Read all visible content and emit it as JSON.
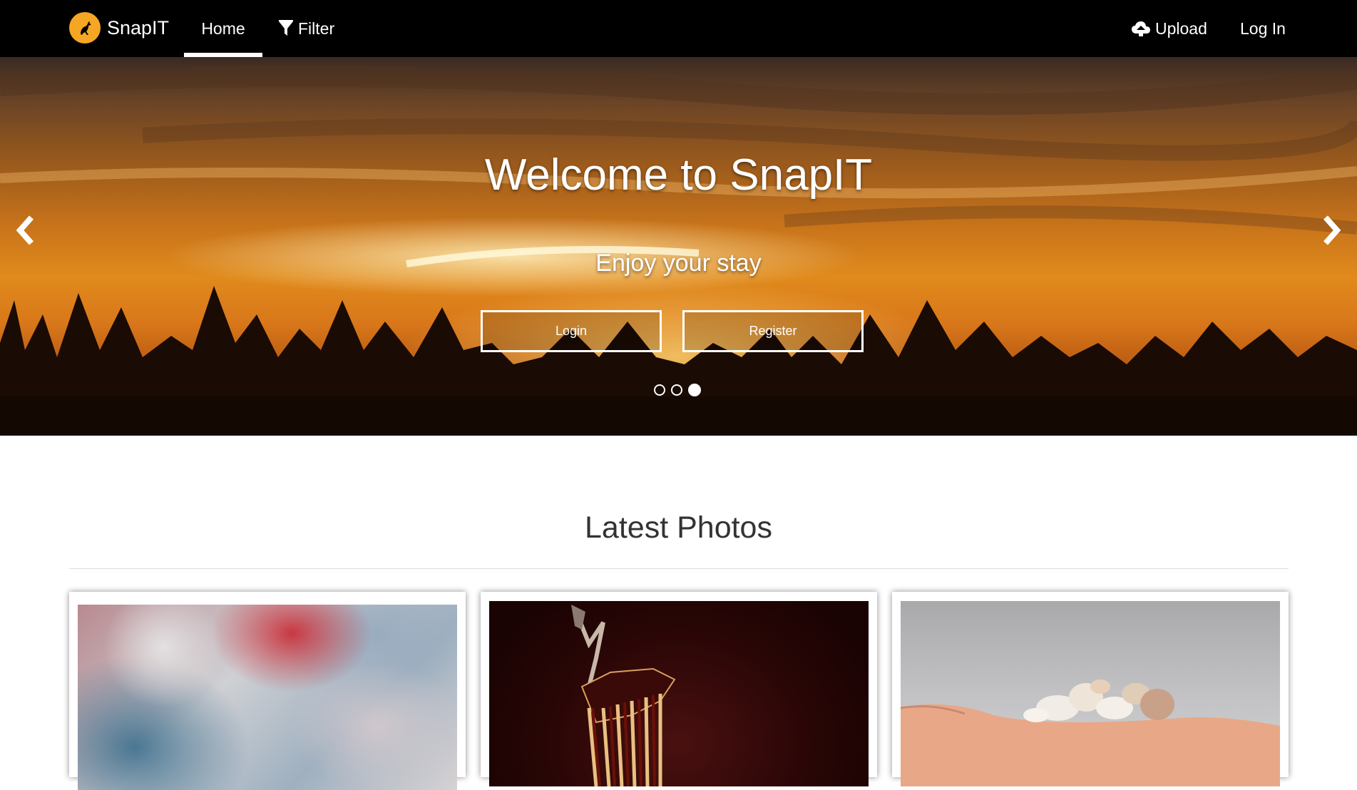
{
  "navbar": {
    "brand": "SnapIT",
    "logo_icon": "kangaroo-logo-icon",
    "links": {
      "home": "Home",
      "filter": "Filter",
      "upload": "Upload",
      "login": "Log In"
    },
    "icons": {
      "filter": "filter-icon",
      "upload": "cloud-upload-icon"
    },
    "active": "home"
  },
  "hero": {
    "title": "Welcome to SnapIT",
    "subtitle": "Enjoy your stay",
    "buttons": {
      "login": "Login",
      "register": "Register"
    },
    "slides_total": 3,
    "active_slide": 3
  },
  "latest": {
    "title": "Latest Photos",
    "photos": [
      {
        "alt": "blurred abstract colors"
      },
      {
        "alt": "dark red zebra artwork"
      },
      {
        "alt": "hand holding seashells"
      }
    ]
  },
  "colors": {
    "navbar_bg": "#000000",
    "brand_accent": "#f5a623",
    "text_light": "#ffffff",
    "heading": "#333333"
  }
}
